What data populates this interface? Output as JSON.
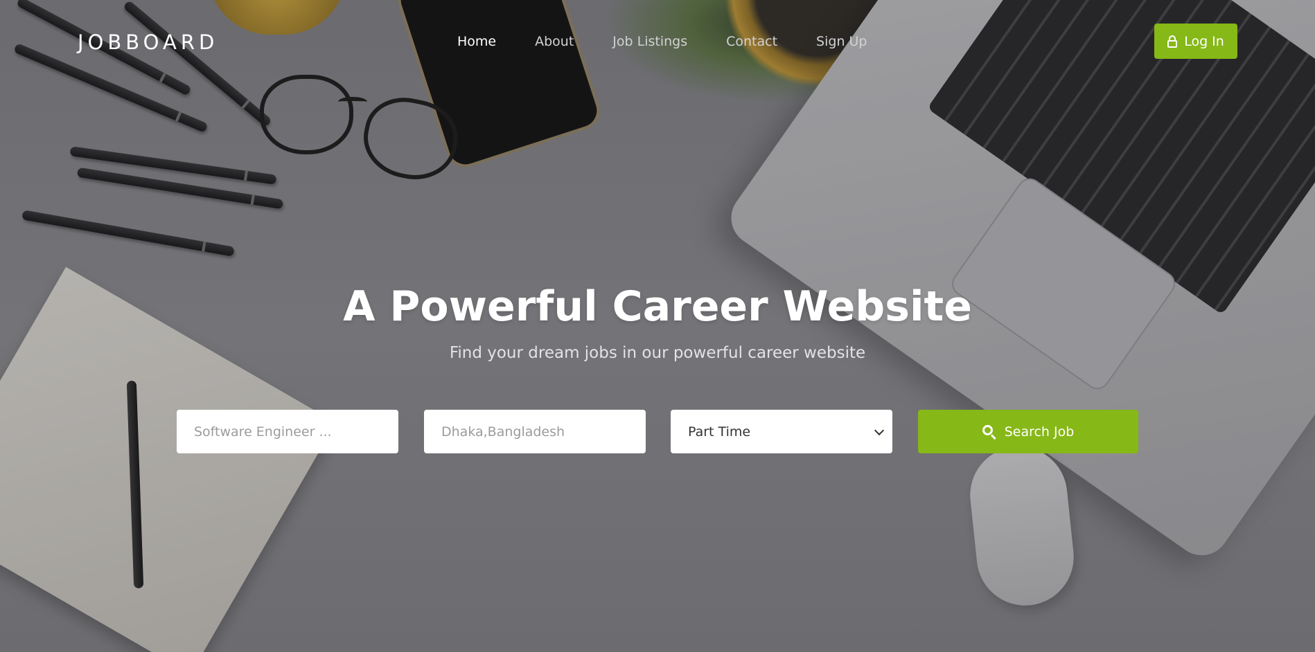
{
  "brand": {
    "logo": "JOBBOARD"
  },
  "nav": {
    "items": [
      {
        "label": "Home",
        "active": true
      },
      {
        "label": "About",
        "active": false
      },
      {
        "label": "Job Listings",
        "active": false
      },
      {
        "label": "Contact",
        "active": false
      },
      {
        "label": "Sign Up",
        "active": false
      }
    ],
    "login": {
      "label": "Log In",
      "icon": "lock-icon"
    }
  },
  "hero": {
    "title": "A Powerful Career Website",
    "subtitle": "Find your dream jobs in our powerful career website"
  },
  "search": {
    "keyword_placeholder": "Software Engineer ...",
    "location_placeholder": "Dhaka,Bangladesh",
    "job_type_selected": "Part Time",
    "button_label": "Search Job",
    "button_icon": "search-icon"
  },
  "colors": {
    "accent": "#86b817",
    "text_light": "#ffffff"
  }
}
